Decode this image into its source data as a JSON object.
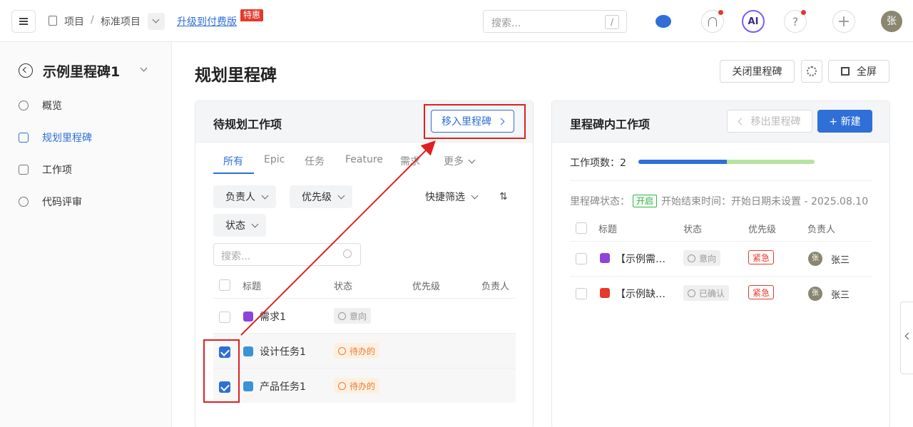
{
  "topbar": {
    "breadcrumb": [
      "项目",
      "/",
      "标准项目"
    ],
    "upgrade_link": "升级到付费版",
    "hot_badge": "特惠",
    "search_placeholder": "搜索...",
    "search_shortcut": "/",
    "ai_label": "AI",
    "help_label": "?",
    "plus_label": "+",
    "avatar": "张"
  },
  "sidebar": {
    "milestone_title": "示例里程碑1",
    "items": [
      {
        "label": "概览",
        "icon": "gauge-icon"
      },
      {
        "label": "规划里程碑",
        "icon": "document-icon",
        "active": true
      },
      {
        "label": "工作项",
        "icon": "list-icon"
      },
      {
        "label": "代码评审",
        "icon": "branch-icon"
      }
    ]
  },
  "page": {
    "title": "规划里程碑",
    "close_button": "关闭里程碑",
    "fullscreen_button": "全屏"
  },
  "left_panel": {
    "title": "待规划工作项",
    "move_button": "移入里程碑",
    "tabs": [
      "所有",
      "Epic",
      "任务",
      "Feature",
      "需求",
      "更多"
    ],
    "filters": {
      "assignee": "负责人",
      "priority": "优先级",
      "quick": "快捷筛选",
      "status": "状态",
      "sort": "⇅"
    },
    "search_placeholder": "搜索...",
    "columns": [
      "标题",
      "状态",
      "优先级",
      "负责人"
    ],
    "rows": [
      {
        "title": "需求1",
        "type": "requirement",
        "status": "意向",
        "checked": false
      },
      {
        "title": "设计任务1",
        "type": "task",
        "status": "待办的",
        "checked": true
      },
      {
        "title": "产品任务1",
        "type": "task",
        "status": "待办的",
        "checked": true
      }
    ]
  },
  "right_panel": {
    "title": "里程碑内工作项",
    "move_out_button": "移出里程碑",
    "new_button": "+ 新建",
    "count_label": "工作项数：2",
    "progress_fraction": 0.5,
    "status_label": "里程碑状态：",
    "status_value": "开启",
    "time_label": "开始结束时间：开始日期未设置 - 2025.08.10",
    "columns": [
      "标题",
      "状态",
      "优先级",
      "负责人"
    ],
    "rows": [
      {
        "title": "【示例需…",
        "type": "requirement",
        "status": "意向",
        "priority": "紧急",
        "assignee_avatar": "张",
        "assignee": "张三"
      },
      {
        "title": "【示例缺…",
        "type": "bug",
        "status": "已确认",
        "priority": "紧急",
        "assignee_avatar": "张",
        "assignee": "张三"
      }
    ]
  },
  "colors": {
    "accent": "#2f6fd7",
    "danger": "#e5392b",
    "todo": "#ed7b2f",
    "success": "#3fb24f"
  }
}
